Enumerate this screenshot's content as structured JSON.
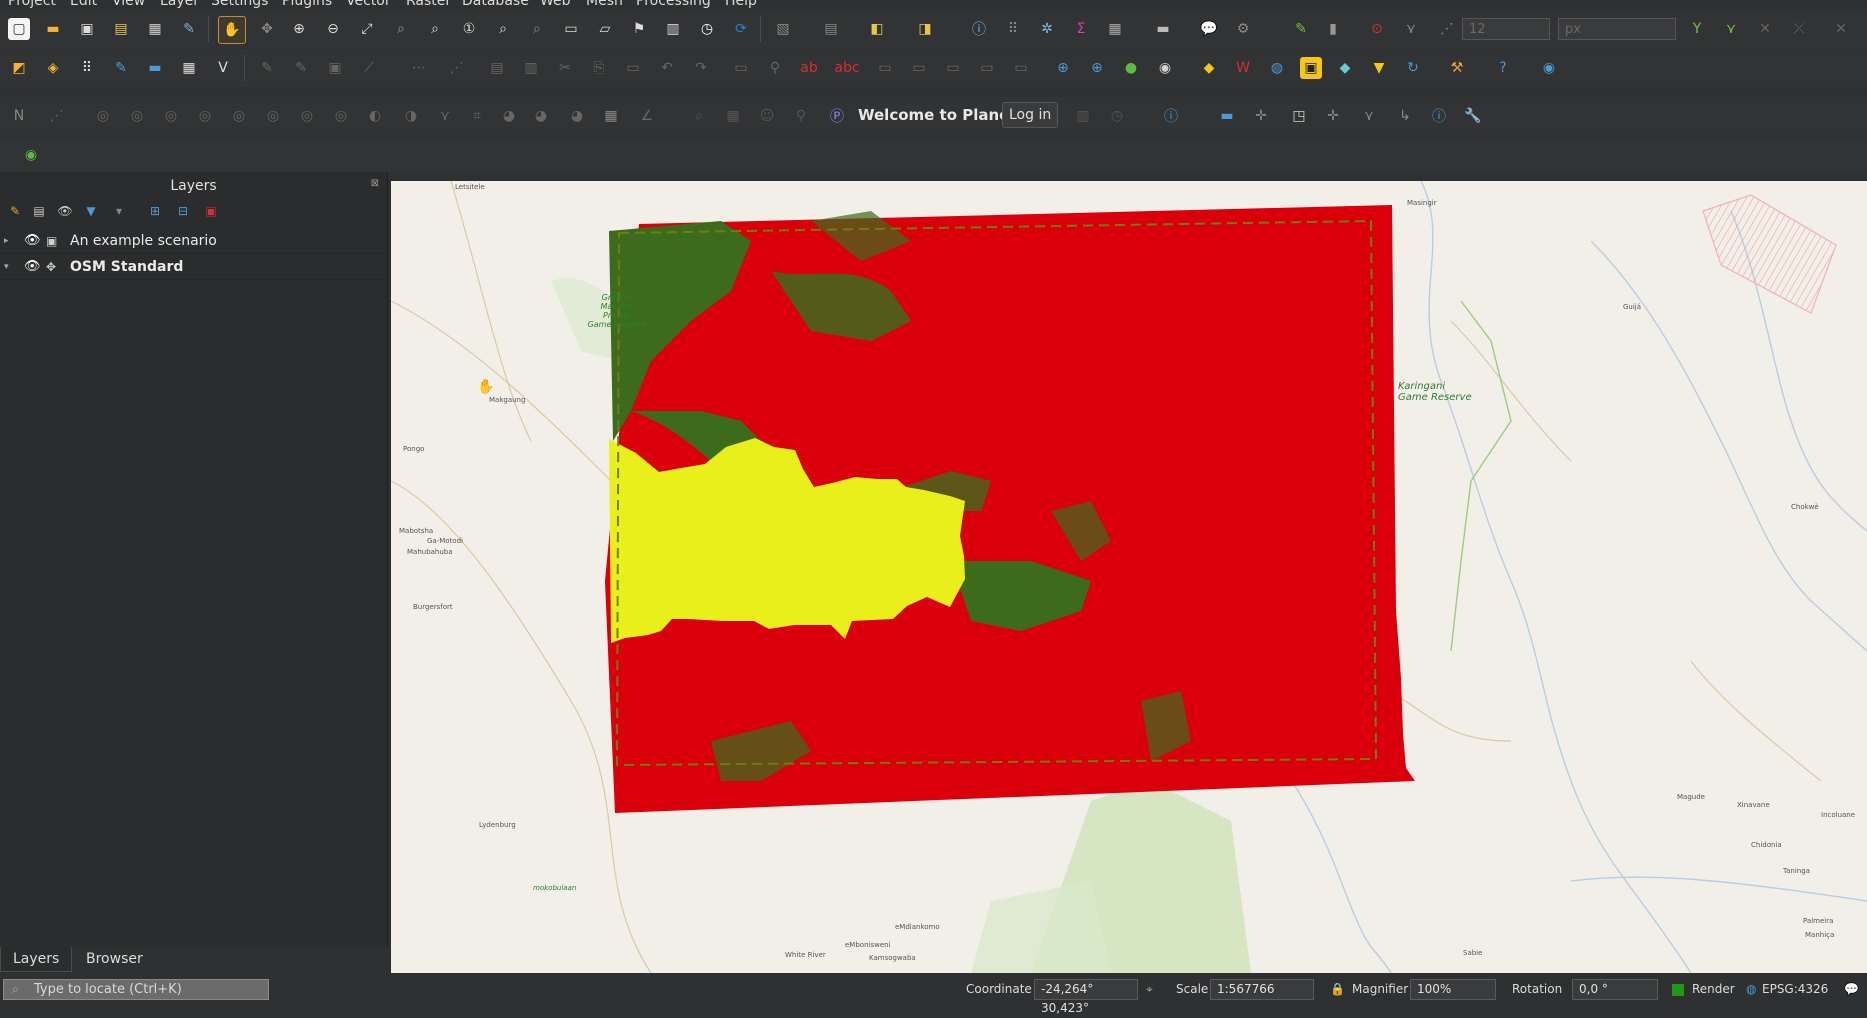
{
  "menu": [
    "Project",
    "Edit",
    "View",
    "Layer",
    "Settings",
    "Plugins",
    "Vector",
    "Raster",
    "Database",
    "Web",
    "Mesh",
    "Processing",
    "Help"
  ],
  "toolbar": {
    "welcome_text": "Welcome to Planet",
    "login_label": "Log in",
    "font_size_value": "12",
    "unit_value": "px"
  },
  "layers_panel": {
    "title": "Layers",
    "layers": [
      {
        "name": "An example scenario",
        "visible": true,
        "expanded": false
      },
      {
        "name": "OSM Standard",
        "visible": true,
        "expanded": true
      }
    ],
    "tabs": [
      "Layers",
      "Browser"
    ]
  },
  "map": {
    "place_labels": {
      "greater_makalali": "Greater\nMakalali\nPrivate\nGame Reserve",
      "karingani": "Karingani\nGame Reserve",
      "makgaung": "Makgaung",
      "letsitele": "Letsitele",
      "masingir": "Masingir",
      "guija": "Guijá",
      "chokwe": "Chokwè",
      "mabotsha": "Mabotsha",
      "ga_motodi": "Ga-Motodi",
      "mahubahuba": "Mahubahuba",
      "burgersfort": "Burgersfort",
      "lydenburg": "Lydenburg",
      "white_river": "White River",
      "embonisweni": "eMbonisweni",
      "kamsogwaba": "Kamsogwaba",
      "emdlankomo": "eMdlankomo",
      "magude": "Magude",
      "xinavane": "Xinavane",
      "incoluane": "Incoluane",
      "chidonia": "Chidonia",
      "taninga": "Taninga",
      "palmeira": "Palmeira",
      "manhica": "Manhiça",
      "sabie": "Sabie",
      "pongo": "Pongo",
      "mokobulaan": "mokobulaan"
    },
    "colors": {
      "raster_red": "#d9000b",
      "raster_yellow": "#e8ef1a",
      "raster_green": "#3c6b1c",
      "boundary_dash": "#6b7f16",
      "base": "#f2efe9"
    }
  },
  "statusbar": {
    "locator_placeholder": "Type to locate (Ctrl+K)",
    "coordinate_label": "Coordinate",
    "coordinate_value": "-24,264° 30,423°",
    "scale_label": "Scale",
    "scale_value": "1:567766",
    "magnifier_label": "Magnifier",
    "magnifier_value": "100%",
    "rotation_label": "Rotation",
    "rotation_value": "0,0 °",
    "render_label": "Render",
    "crs_value": "EPSG:4326"
  }
}
